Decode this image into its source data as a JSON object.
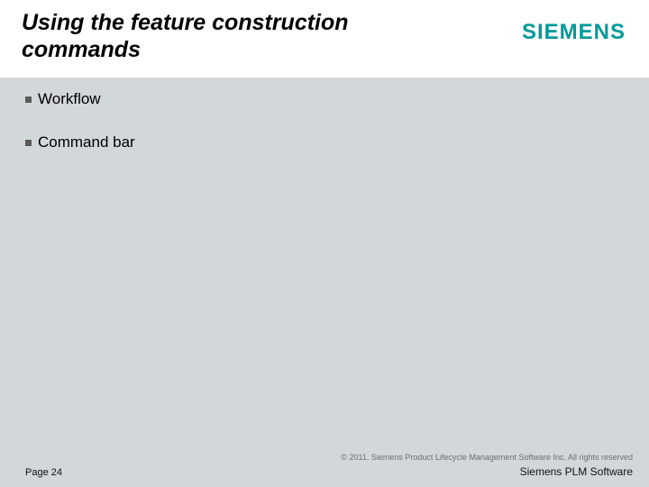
{
  "header": {
    "title": "Using the feature construction commands",
    "logo_text": "SIEMENS"
  },
  "content": {
    "bullets": [
      {
        "text": "Workflow"
      },
      {
        "text": "Command bar"
      }
    ]
  },
  "footer": {
    "copyright": "© 2011. Siemens Product Lifecycle Management Software Inc. All rights reserved",
    "page": "Page 24",
    "brand": "Siemens PLM Software"
  }
}
